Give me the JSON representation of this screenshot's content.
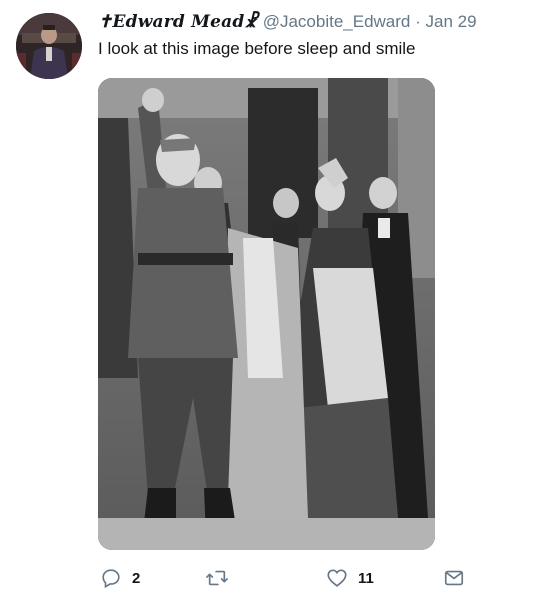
{
  "tweet": {
    "display_name": "✝Edward Mead☧",
    "handle": "@Jacobite_Edward",
    "separator": "·",
    "date": "Jan 29",
    "text": "I look at this image before sleep and smile"
  },
  "actions": {
    "reply_count": "2",
    "retweet_count": "",
    "like_count": "11"
  },
  "icons": {
    "reply": "reply-icon",
    "retweet": "retweet-icon",
    "like": "heart-icon",
    "dm": "envelope-icon"
  },
  "colors": {
    "text": "#14171a",
    "secondary": "#657786",
    "background": "#ffffff"
  }
}
